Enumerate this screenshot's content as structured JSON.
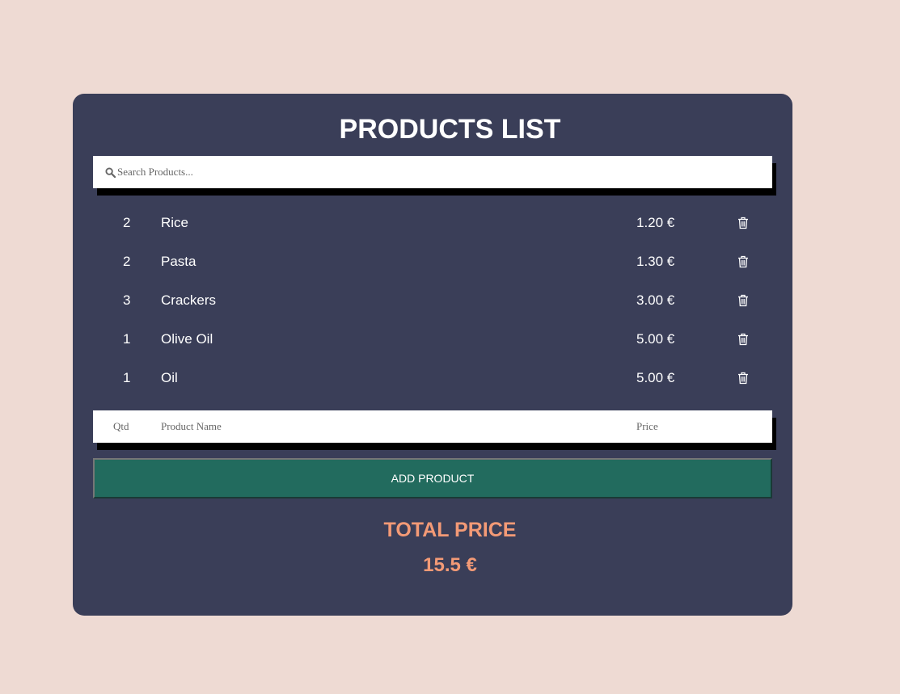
{
  "header": {
    "title": "PRODUCTS LIST"
  },
  "search": {
    "placeholder": "Search Products...",
    "value": ""
  },
  "products": [
    {
      "qty": "2",
      "name": "Rice",
      "price": "1.20 €"
    },
    {
      "qty": "2",
      "name": "Pasta",
      "price": "1.30 €"
    },
    {
      "qty": "3",
      "name": "Crackers",
      "price": "3.00 €"
    },
    {
      "qty": "1",
      "name": "Olive Oil",
      "price": "5.00 €"
    },
    {
      "qty": "1",
      "name": "Oil",
      "price": "5.00 €"
    }
  ],
  "form": {
    "qty_placeholder": "Qtd",
    "name_placeholder": "Product Name",
    "price_placeholder": "Price",
    "add_label": "ADD PRODUCT"
  },
  "total": {
    "label": "TOTAL PRICE",
    "value": "15.5 €"
  },
  "colors": {
    "background": "#eedad3",
    "card": "#3a3e58",
    "button": "#226b5e",
    "accent": "#f39a76"
  },
  "icons": {
    "search": "search-icon",
    "delete": "trash-icon"
  }
}
